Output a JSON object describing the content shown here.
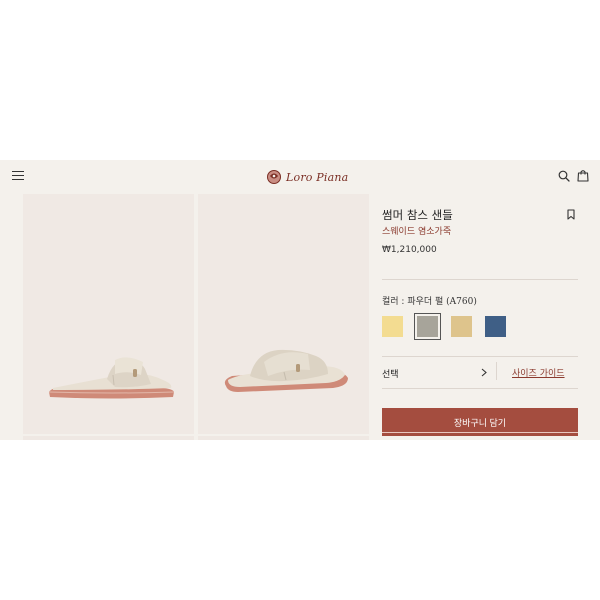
{
  "header": {
    "brand": "Loro Piana",
    "icons": {
      "menu": "hamburger-menu-icon",
      "search": "search-icon",
      "bag": "shopping-bag-icon",
      "logo": "loro-piana-emblem"
    }
  },
  "product": {
    "title": "썸머 참스 샌들",
    "subtitle": "스웨이드 염소가죽",
    "price": "₩1,210,000",
    "color_prefix": "컬러 : ",
    "color_name": "파우더 펄 (A760)",
    "swatches": [
      {
        "name": "yellow",
        "color": "#f3dc91",
        "selected": false
      },
      {
        "name": "grey",
        "color": "#a7a49a",
        "selected": true
      },
      {
        "name": "sand",
        "color": "#dec48c",
        "selected": false
      },
      {
        "name": "blue",
        "color": "#3f5f86",
        "selected": false
      }
    ],
    "size_select_label": "선택",
    "size_guide_label": "사이즈 가이드",
    "add_to_cart_label": "장바구니 담기"
  },
  "colors": {
    "background": "#f4f1ec",
    "tile_background": "#f0e9e4",
    "accent": "#a44d3f",
    "brand_text": "#7a2e24"
  }
}
